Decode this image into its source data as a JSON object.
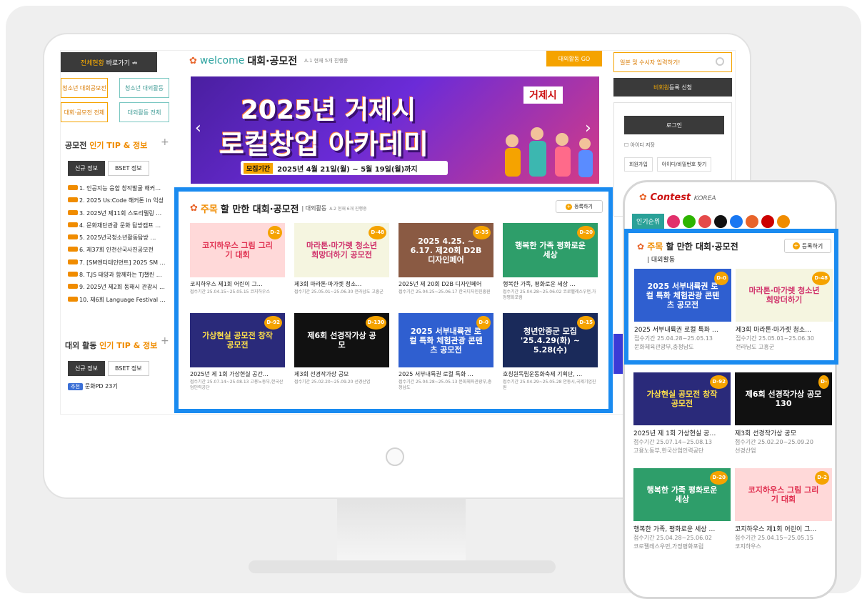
{
  "left": {
    "quick_nav": {
      "highlight": "전체현황",
      "rest": "바로가기 ⇏"
    },
    "boxes": [
      "청소년 대회공모전",
      "청소년 대외활동",
      "대회·공모전 전체",
      "대외활동 전체"
    ],
    "section1": {
      "title_prefix": "공모전 ",
      "title_hl": "인기 TIP & 정보",
      "plus": "+"
    },
    "tabs": [
      "신규 정보",
      "BSET 정보"
    ],
    "list": [
      "1. 인공지능 융합 창작발굴 해커…",
      "2. 2025 Us:Code 해커톤 in 익성",
      "3. 2025년 제11회 스토리텔링 …",
      "4. 문화재단관광 문화 탐방캠프 …",
      "5. 2025년국청소년활동탐방 …",
      "6. 제37회 인천산국사진공모전",
      "7. [SM엔터테인먼트] 2025 SM …",
      "8. T.JS 태양과 함께하는 TJ챌린 …",
      "9. 2025년 제2회 동해시 관광시 …",
      "10. 제6회 Language Festival …"
    ],
    "section2": {
      "title_prefix": "대외 활동 ",
      "title_hl": "인기 TIP & 정보",
      "plus": "+"
    },
    "tabs2": [
      "신규 정보",
      "BSET 정보"
    ],
    "list2_tag": "추천",
    "list2_first": "문화PD 23기"
  },
  "center": {
    "welcome": "welcome",
    "welcome_title": "대회·공모전",
    "welcome_sub": "A.1 현재 5개 진행중",
    "go_btn": "대외활동 GO",
    "banner": {
      "line1": "2025년 거제시",
      "line2": "로컬창업 아카데미",
      "period_label": "모집기간",
      "period": "2025년 4월 21일(월) ~ 5월 19일(월)까지",
      "logo": "거제시"
    }
  },
  "right": {
    "search": "일본 및 수시자 입력하기!",
    "signup_hl": "비회원",
    "signup_rest": " 등록 신청",
    "login_btn": "로그인",
    "save_id": "아이디 저장",
    "links": [
      "회원가입",
      "아이디/비밀번호 찾기"
    ]
  },
  "highlight": {
    "title_hl": "주목",
    "title": " 할 만한 대회·공모전",
    "sub": "| 대외활동",
    "sub2": "A.2 현재 6개 진행중",
    "more": "등록하기",
    "cards": [
      {
        "thumb": "코지하우스 그림 그리기 대회",
        "dday": "D-2",
        "title": "코지하우스 제1회 어린이 그…",
        "meta": "접수기간 25.04.15~25.05.15 코지하우스",
        "bg": "#ffd9d9",
        "fg": "#e03050"
      },
      {
        "thumb": "마라톤·마가렛 청소년 희망더하기 공모전",
        "dday": "D-48",
        "title": "제3회 마라톤·마가렛 청소…",
        "meta": "접수기간 25.05.01~25.06.30 전라남도 고흥군",
        "bg": "#f5f5e0",
        "fg": "#d0306a"
      },
      {
        "thumb": "2025 4.25. ~ 6.17. 제20회 D2B 디자인페어",
        "dday": "D-35",
        "title": "2025년 제 20회 D2B 디자인페어",
        "meta": "접수기간 25.04.25~25.06.17 한국디자인진흥원",
        "bg": "#8a5a43",
        "fg": "#ffffff"
      },
      {
        "thumb": "행복한 가족 평화로운 세상",
        "dday": "D-20",
        "title": "행복한 가족, 평화로운 세상 …",
        "meta": "접수기간 25.04.28~25.06.02 코로펠레스우먼,가정평화포럼",
        "bg": "#2e9e6a",
        "fg": "#ffffff"
      },
      {
        "thumb": "가상현실 공모전 창작 공모전",
        "dday": "D-92",
        "title": "2025년 제 1회 가상현실 공간…",
        "meta": "접수기간 25.07.14~25.08.13 고용노동부,한국산업인력공단",
        "bg": "#2a2a7a",
        "fg": "#ffe04a"
      },
      {
        "thumb": "제6회 선경작가상 공모",
        "dday": "D-130",
        "title": "제3회 선경작가상 공모",
        "meta": "접수기간 25.02.20~25.09.20 선경산업",
        "bg": "#111111",
        "fg": "#ffffff"
      },
      {
        "thumb": "2025 서부내륙권 로컬 특화 체험관광 콘텐츠 공모전",
        "dday": "D-0",
        "title": "2025 서부내륙권 로컬 특화 …",
        "meta": "접수기간 25.04.28~25.05.13 문화체육관광부,충청남도",
        "bg": "#2f5fd0",
        "fg": "#ffffff"
      },
      {
        "thumb": "청년안중군 모집 '25.4.29(화) ~ 5.28(수)",
        "dday": "D-15",
        "title": "호칭원독립운동화축제 기획단, …",
        "meta": "접수기간 25.04.29~25.05.28 안동시,국제기업진원",
        "bg": "#1a2a5a",
        "fg": "#ffffff"
      }
    ]
  },
  "phone": {
    "logo": "Contest",
    "logo_sub": "KOREA",
    "popular": "인기순위",
    "title_hl": "주목",
    "title": " 할 만한 대회·공모전",
    "sub": "| 대외활동",
    "more": "등록하기",
    "cards": [
      {
        "thumb": "2025 서부내륙권 로컬 특화 체험관광 콘텐츠 공모전",
        "dday": "D-0",
        "title": "2025 서부내륙권 로컬 특화 …",
        "meta1": "접수기간 25.04.28~25.05.13",
        "meta2": "문화체육관광부,충청남도",
        "bg": "#2f5fd0",
        "fg": "#ffffff"
      },
      {
        "thumb": "마라톤·마가렛 청소년 희망더하기",
        "dday": "D-48",
        "title": "제3회 마라톤·마가렛 청소…",
        "meta1": "접수기간 25.05.01~25.06.30",
        "meta2": "전라남도 고흥군",
        "bg": "#f5f5e0",
        "fg": "#d0306a"
      },
      {
        "thumb": "가상현실 공모전 창작 공모전",
        "dday": "D-92",
        "title": "2025년 제 1회 가상현실 공…",
        "meta1": "접수기간 25.07.14~25.08.13",
        "meta2": "고용노동부,한국산업인력공단",
        "bg": "#2a2a7a",
        "fg": "#ffe04a"
      },
      {
        "thumb": "제6회 선경작가상 공모 130",
        "dday": "D-",
        "title": "제3회 선경작가상 공모",
        "meta1": "접수기간 25.02.20~25.09.20",
        "meta2": "선경산업",
        "bg": "#111111",
        "fg": "#ffffff"
      },
      {
        "thumb": "행복한 가족 평화로운 세상",
        "dday": "D-20",
        "title": "행복한 가족, 평화로운 세상 …",
        "meta1": "접수기간 25.04.28~25.06.02",
        "meta2": "코로펠레스우먼,가정평화포럼",
        "bg": "#2e9e6a",
        "fg": "#ffffff"
      },
      {
        "thumb": "코지하우스 그림 그리기 대회",
        "dday": "D-2",
        "title": "코지하우스 제1회 어린이 그…",
        "meta1": "접수기간 25.04.15~25.05.15",
        "meta2": "코지하우스",
        "bg": "#ffd9d9",
        "fg": "#e03050"
      }
    ]
  }
}
